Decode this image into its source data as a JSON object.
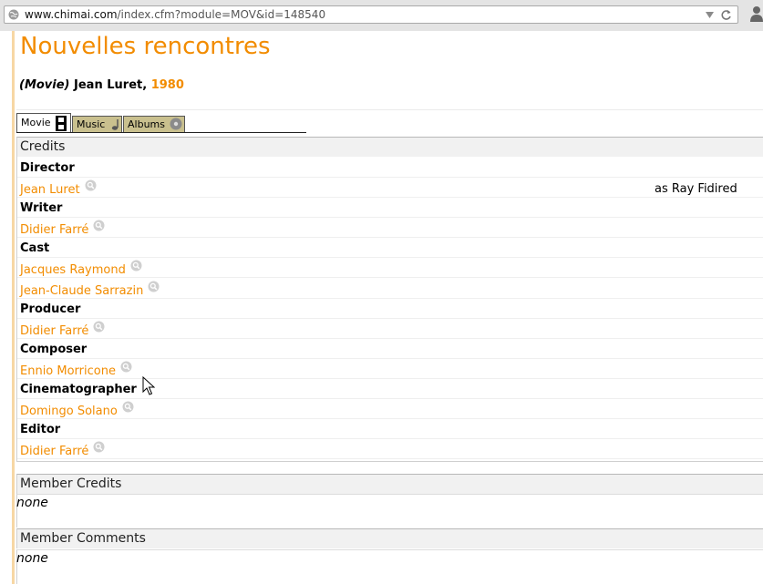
{
  "browser": {
    "url_host": "www.chimai.com",
    "url_path": "/index.cfm?module=MOV&id=148540"
  },
  "page": {
    "title": "Nouvelles rencontres",
    "kind": "(Movie)",
    "director_name": "Jean Luret,",
    "year": "1980"
  },
  "tabs": [
    {
      "label": "Movie",
      "icon": "film-icon",
      "active": true
    },
    {
      "label": "Music",
      "icon": "music-note-icon",
      "active": false
    },
    {
      "label": "Albums",
      "icon": "disc-icon",
      "active": false
    }
  ],
  "credits": {
    "header": "Credits",
    "rows": [
      {
        "type": "role",
        "text": "Director"
      },
      {
        "type": "person",
        "text": "Jean Luret",
        "as": "as Ray Fidired"
      },
      {
        "type": "role",
        "text": "Writer"
      },
      {
        "type": "person",
        "text": "Didier Farré"
      },
      {
        "type": "role",
        "text": "Cast"
      },
      {
        "type": "person",
        "text": "Jacques Raymond"
      },
      {
        "type": "person",
        "text": "Jean-Claude Sarrazin"
      },
      {
        "type": "role",
        "text": "Producer"
      },
      {
        "type": "person",
        "text": "Didier Farré"
      },
      {
        "type": "role",
        "text": "Composer"
      },
      {
        "type": "person",
        "text": "Ennio Morricone"
      },
      {
        "type": "role",
        "text": "Cinematographer"
      },
      {
        "type": "person",
        "text": "Domingo Solano"
      },
      {
        "type": "role",
        "text": "Editor"
      },
      {
        "type": "person",
        "text": "Didier Farré"
      }
    ]
  },
  "member_credits": {
    "header": "Member Credits",
    "body": "none"
  },
  "member_comments": {
    "header": "Member Comments",
    "body": "none"
  },
  "colors": {
    "accent": "#f28c00",
    "tab_inactive": "#c9c08e"
  }
}
